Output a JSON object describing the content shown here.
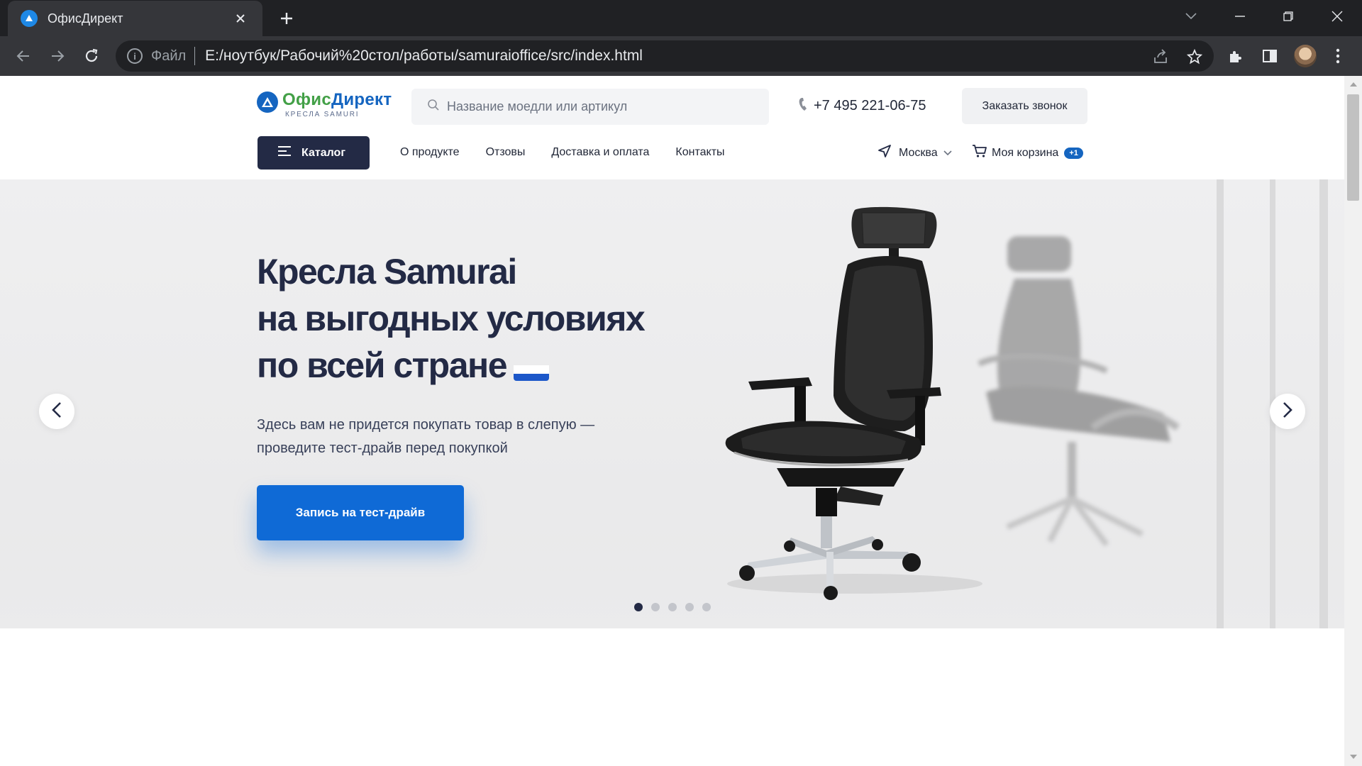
{
  "browser": {
    "tab_title": "ОфисДирект",
    "omnibox_scheme": "Файл",
    "url": "E:/ноутбук/Рабочий%20стол/работы/samuraioffice/src/index.html"
  },
  "header": {
    "logo_name_part1": "Офис",
    "logo_name_part2": "Директ",
    "logo_sub": "КРЕСЛА SAMURI",
    "search_placeholder": "Название моедли или артикул",
    "phone": "+7 495 221-06-75",
    "call_button": "Заказать звонок"
  },
  "nav": {
    "catalog": "Каталог",
    "items": [
      "О продукте",
      "Отзовы",
      "Доставка и оплата",
      "Контакты"
    ],
    "city": "Москва",
    "cart_label": "Моя корзина",
    "cart_badge": "+1"
  },
  "hero": {
    "title_line1": "Кресла Samurai",
    "title_line2": "на выгодных условиях",
    "title_line3": "по всей стране",
    "subtitle_line1": "Здесь вам не придется покупать товар в слепую —",
    "subtitle_line2": "проведите тест-драйв перед покупкой",
    "cta": "Запись на тест-драйв",
    "slides_total": 5,
    "slide_active": 1
  },
  "colors": {
    "brand_dark": "#232a45",
    "brand_blue": "#0f6ad6",
    "logo_green": "#43a047",
    "logo_blue": "#1565c0"
  }
}
